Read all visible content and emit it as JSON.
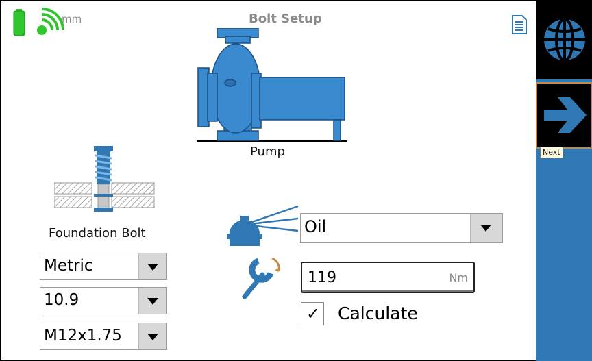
{
  "header": {
    "unit": "mm",
    "title": "Bolt Setup"
  },
  "pump": {
    "label": "Pump"
  },
  "bolt": {
    "label": "Foundation Bolt",
    "system": "Metric",
    "grade": "10.9",
    "size": "M12x1.75"
  },
  "lubrication": {
    "value": "Oil"
  },
  "torque": {
    "value": "119",
    "unit": "Nm"
  },
  "calculate": {
    "label": "Calculate",
    "checked": true,
    "check_glyph": "✓"
  },
  "side_panel": {
    "next_tooltip": "Next"
  },
  "colors": {
    "accent": "#2f78b4",
    "battery": "#2ec52e",
    "wifi": "#2ec52e"
  }
}
